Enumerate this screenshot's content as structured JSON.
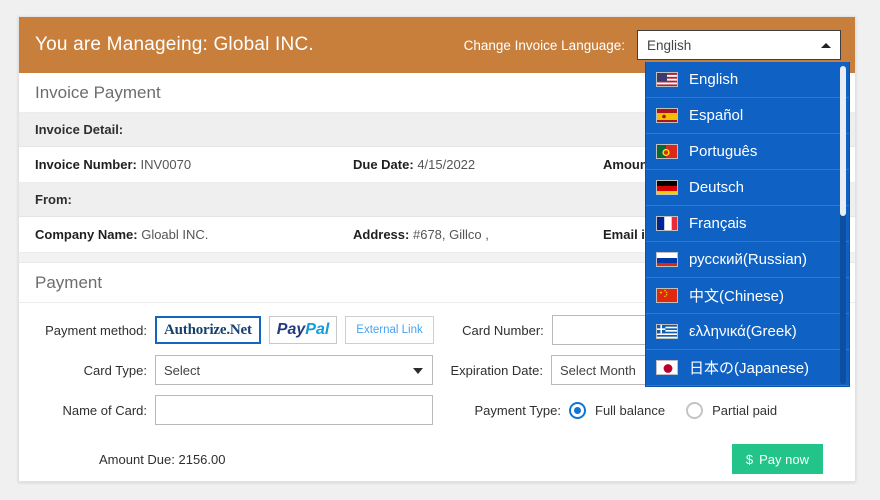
{
  "header": {
    "managing_title": "You are Manageing: Global INC.",
    "lang_label": "Change Invoice Language:",
    "lang_selected": "English",
    "bg_color": "#c87f3c"
  },
  "page": {
    "section_title": "Invoice Payment",
    "payment_title": "Payment"
  },
  "invoice_detail": {
    "bar_label": "Invoice Detail:",
    "number_label": "Invoice Number:",
    "number_value": "INV0070",
    "due_label": "Due Date:",
    "due_value": "4/15/2022",
    "amount_label": "Amount"
  },
  "from": {
    "bar_label": "From:",
    "company_label": "Company Name:",
    "company_value": "Gloabl INC.",
    "address_label": "Address:",
    "address_value": "#678, Gillco ,",
    "email_label": "Email id:"
  },
  "payment": {
    "method_label": "Payment method:",
    "authorize_net": "Authorize.Net",
    "paypal_first": "Pay",
    "paypal_second": "Pal",
    "external_link": "External Link",
    "card_number_label": "Card Number:",
    "card_number_value": "",
    "card_type_label": "Card Type:",
    "card_type_value": "Select",
    "expiration_label": "Expiration Date:",
    "expiration_month": "Select Month",
    "expiration_year": "",
    "name_of_card_label": "Name of Card:",
    "name_of_card_value": "",
    "payment_type_label": "Payment Type:",
    "full_balance_label": "Full balance",
    "partial_paid_label": "Partial paid",
    "amount_due_label": "Amount Due: 2156.00",
    "pay_now_icon": "$",
    "pay_now_label": "Pay now",
    "pay_now_color": "#22c48a"
  },
  "dropdown": {
    "open": true,
    "highlight_color": "#0f62c4",
    "items": [
      {
        "label": "English",
        "icon": "flag-us-icon"
      },
      {
        "label": "Español",
        "icon": "flag-es-icon"
      },
      {
        "label": "Português",
        "icon": "flag-pt-icon"
      },
      {
        "label": "Deutsch",
        "icon": "flag-de-icon"
      },
      {
        "label": "Français",
        "icon": "flag-fr-icon"
      },
      {
        "label": "русский(Russian)",
        "icon": "flag-ru-icon"
      },
      {
        "label": "中文(Chinese)",
        "icon": "flag-cn-icon"
      },
      {
        "label": "ελληνικά(Greek)",
        "icon": "flag-gr-icon"
      },
      {
        "label": "日本の(Japanese)",
        "icon": "flag-jp-icon"
      }
    ]
  }
}
